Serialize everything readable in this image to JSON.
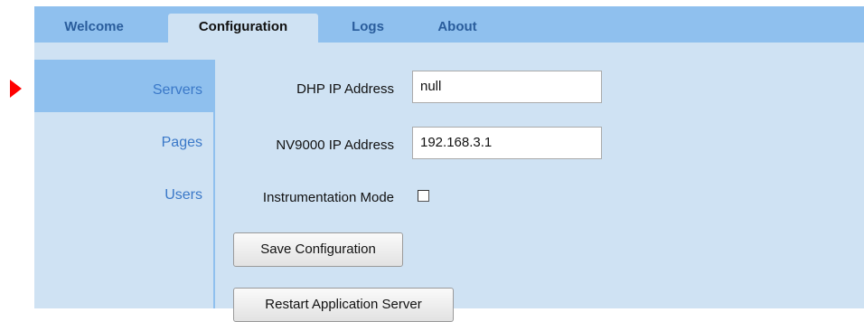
{
  "tabs": [
    {
      "label": "Welcome",
      "active": false
    },
    {
      "label": "Configuration",
      "active": true
    },
    {
      "label": "Logs",
      "active": false
    },
    {
      "label": "About",
      "active": false
    }
  ],
  "sidebar": {
    "items": [
      {
        "label": "Servers",
        "active": true
      },
      {
        "label": "Pages",
        "active": false
      },
      {
        "label": "Users",
        "active": false
      }
    ]
  },
  "form": {
    "dhp_label": "DHP IP Address",
    "dhp_value": "null",
    "nv9000_label": "NV9000 IP Address",
    "nv9000_value": "192.168.3.1",
    "instrumentation_label": "Instrumentation Mode",
    "instrumentation_checked": false,
    "save_label": "Save Configuration",
    "restart_label": "Restart Application Server"
  },
  "colors": {
    "tabbar": "#8fc0ee",
    "panel": "#cfe2f3",
    "tab_text": "#2a5d9c",
    "sidebar_text": "#3a78c8",
    "pointer": "#ff0000"
  },
  "icons": {
    "pointer": "selection-arrow-icon"
  }
}
